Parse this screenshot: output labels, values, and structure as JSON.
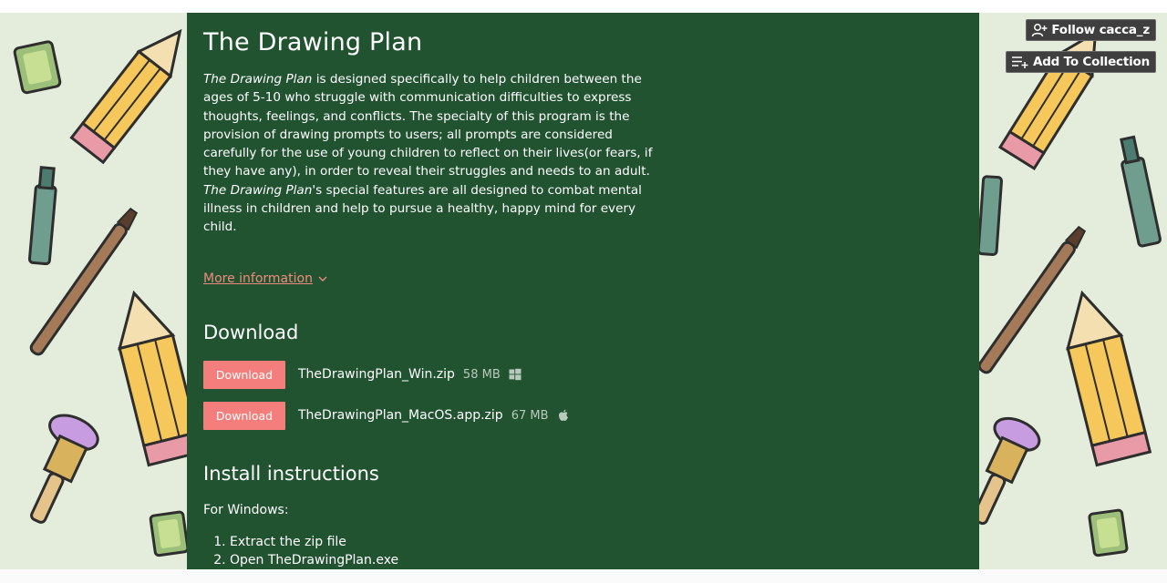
{
  "header_actions": {
    "follow_label": "Follow cacca_z",
    "collection_label": "Add To Collection"
  },
  "game": {
    "title": "The Drawing Plan",
    "description": {
      "italic_name": "The Drawing Plan",
      "part1": " is designed specifically to help children between the ages of 5-10 who struggle with communication difficulties to express thoughts, feelings, and conflicts. The specialty of this program is the provision of drawing prompts to users; all prompts are considered carefully for the use of young children to reflect on their lives(or fears, if they have any), in order to reveal their struggles and needs to an adult. ",
      "italic_name2": "The Drawing Plan",
      "part2": "'s special features are all designed to combat mental illness in children and help to pursue a healthy, happy mind for every child."
    },
    "more_info_label": "More information"
  },
  "download": {
    "heading": "Download",
    "files": [
      {
        "button": "Download",
        "name": "TheDrawingPlan_Win.zip",
        "size": "58 MB",
        "icon": "windows-icon"
      },
      {
        "button": "Download",
        "name": "TheDrawingPlan_MacOS.app.zip",
        "size": "67 MB",
        "icon": "apple-icon"
      }
    ]
  },
  "install": {
    "heading": "Install instructions",
    "platform": "For Windows:",
    "steps": [
      "Extract the zip file",
      "Open TheDrawingPlan.exe"
    ]
  },
  "colors": {
    "page_bg": "#215331",
    "accent": "#f47e7b",
    "link": "#f08a7e",
    "background": "#e4ecdc"
  }
}
